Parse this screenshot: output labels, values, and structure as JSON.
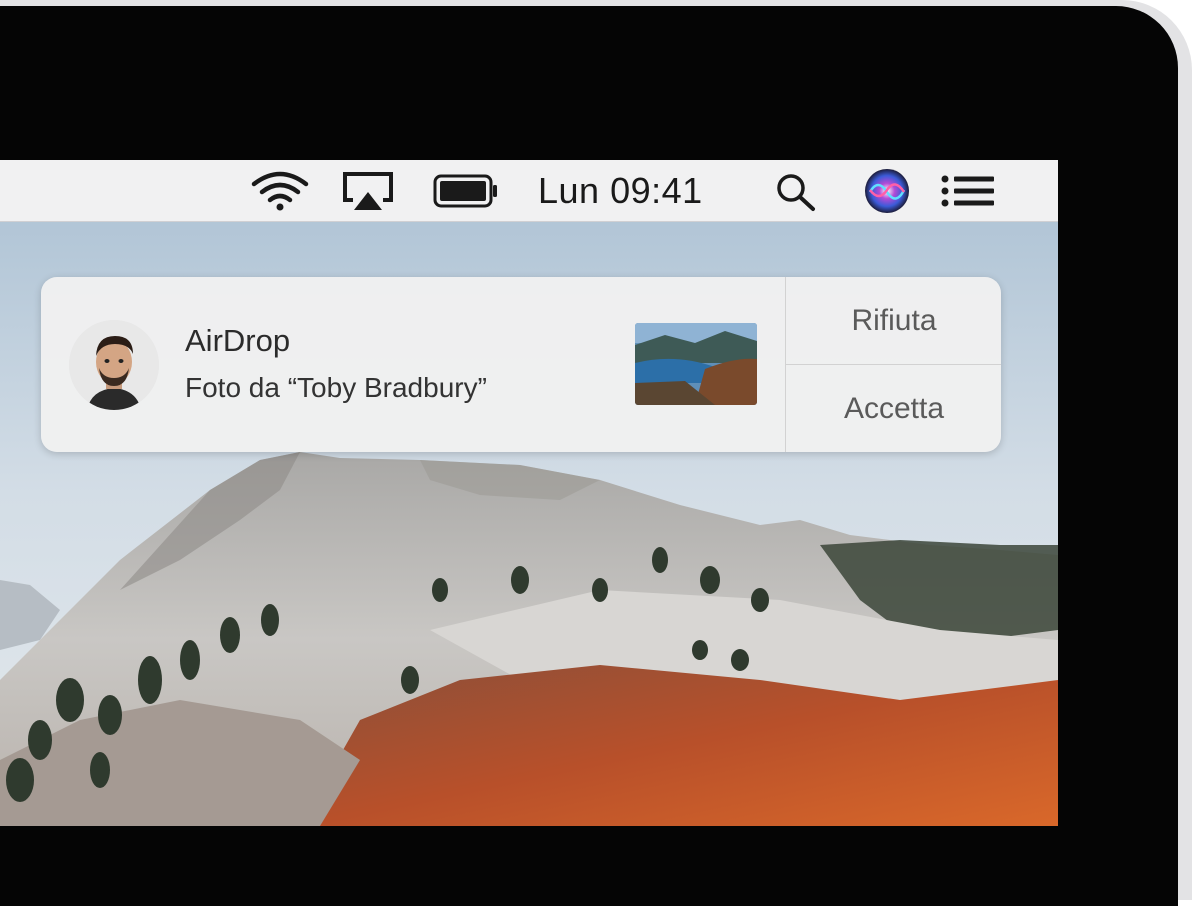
{
  "menubar": {
    "clock": "Lun 09:41",
    "icons": [
      "wifi-icon",
      "airplay-icon",
      "battery-icon",
      "spotlight-search-icon",
      "siri-icon",
      "notification-center-icon"
    ]
  },
  "notification": {
    "app_title": "AirDrop",
    "message": "Foto da “Toby Bradbury”",
    "decline_label": "Rifiuta",
    "accept_label": "Accetta"
  },
  "colors": {
    "menubar_bg": "#f1f1f2",
    "notification_bg": "#f0f0f0",
    "bezel": "#050505"
  }
}
